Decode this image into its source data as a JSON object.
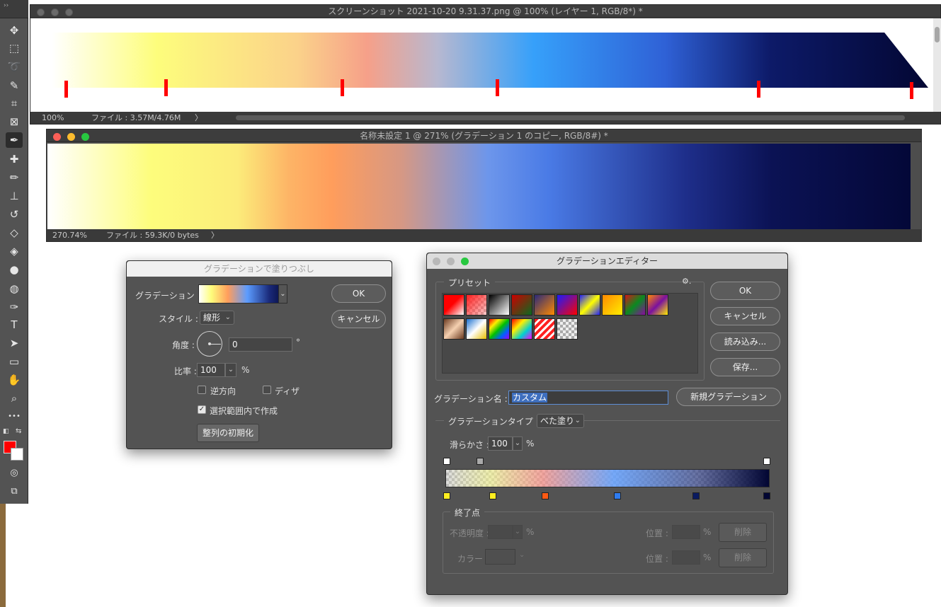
{
  "toolbar": {
    "collapse_glyph": "››",
    "tools": [
      {
        "name": "move-tool-icon",
        "glyph": "✥"
      },
      {
        "name": "marquee-tool-icon",
        "glyph": "⬚"
      },
      {
        "name": "lasso-tool-icon",
        "glyph": "➰"
      },
      {
        "name": "quick-select-tool-icon",
        "glyph": "✎"
      },
      {
        "name": "crop-tool-icon",
        "glyph": "⌗"
      },
      {
        "name": "frame-tool-icon",
        "glyph": "⊠"
      },
      {
        "name": "eyedropper-tool-icon",
        "glyph": "✒"
      },
      {
        "name": "healing-brush-tool-icon",
        "glyph": "✚"
      },
      {
        "name": "brush-tool-icon",
        "glyph": "✏"
      },
      {
        "name": "stamp-tool-icon",
        "glyph": "⊥"
      },
      {
        "name": "history-brush-tool-icon",
        "glyph": "↺"
      },
      {
        "name": "eraser-tool-icon",
        "glyph": "◇"
      },
      {
        "name": "paint-bucket-tool-icon",
        "glyph": "◈"
      },
      {
        "name": "blur-tool-icon",
        "glyph": "●"
      },
      {
        "name": "dodge-tool-icon",
        "glyph": "◍"
      },
      {
        "name": "pen-tool-icon",
        "glyph": "✑"
      },
      {
        "name": "type-tool-icon",
        "glyph": "T"
      },
      {
        "name": "path-select-tool-icon",
        "glyph": "➤"
      },
      {
        "name": "rectangle-tool-icon",
        "glyph": "▭"
      },
      {
        "name": "hand-tool-icon",
        "glyph": "✋"
      },
      {
        "name": "zoom-tool-icon",
        "glyph": "⌕"
      },
      {
        "name": "more-tools-icon",
        "glyph": "•••"
      }
    ],
    "colors": {
      "foreground": "#ff0000",
      "background": "#ffffff"
    }
  },
  "doc1": {
    "title": "スクリーンショット 2021-10-20 9.31.37.png @ 100% (レイヤー 1, RGB/8*) *",
    "zoom": "100%",
    "file_info": "ファイル : 3.57M/4.76M",
    "arrow": "〉"
  },
  "doc2": {
    "title": "名称未設定 1 @ 271% (グラデーション 1 のコピー, RGB/8#) *",
    "zoom": "270.74%",
    "file_info": "ファイル : 59.3K/0 bytes",
    "arrow": "〉"
  },
  "fill_dialog": {
    "title": "グラデーションで塗りつぶし",
    "gradient_label": "グラデーション :",
    "style_label": "スタイル :",
    "style_value": "線形",
    "angle_label": "角度 :",
    "angle_value": "0",
    "angle_unit": "°",
    "scale_label": "比率 :",
    "scale_value": "100",
    "scale_unit": "%",
    "reverse_label": "逆方向",
    "dither_label": "ディザ",
    "align_label": "選択範囲内で作成",
    "reset_button": "整列の初期化",
    "ok": "OK",
    "cancel": "キャンセル"
  },
  "editor": {
    "title": "グラデーションエディター",
    "presets_label": "プリセット",
    "gear_glyph": "⚙.",
    "ok": "OK",
    "cancel": "キャンセル",
    "load": "読み込み...",
    "save": "保存...",
    "name_label": "グラデーション名 :",
    "name_value": "カスタム",
    "new_button": "新規グラデーション",
    "type_label": "グラデーションタイプ :",
    "type_value": "べた塗り",
    "smooth_label": "滑らかさ :",
    "smooth_value": "100",
    "smooth_unit": "%",
    "stops_group": "終了点",
    "opacity_label": "不透明度 :",
    "color_label": "カラー :",
    "position_label": "位置 :",
    "percent": "%",
    "delete": "削除"
  },
  "colors": {
    "gradient_stops": [
      "#ffffff",
      "#fffe7a",
      "#ffa25a",
      "#5c9cff",
      "#1a2a7a",
      "#020633"
    ]
  }
}
